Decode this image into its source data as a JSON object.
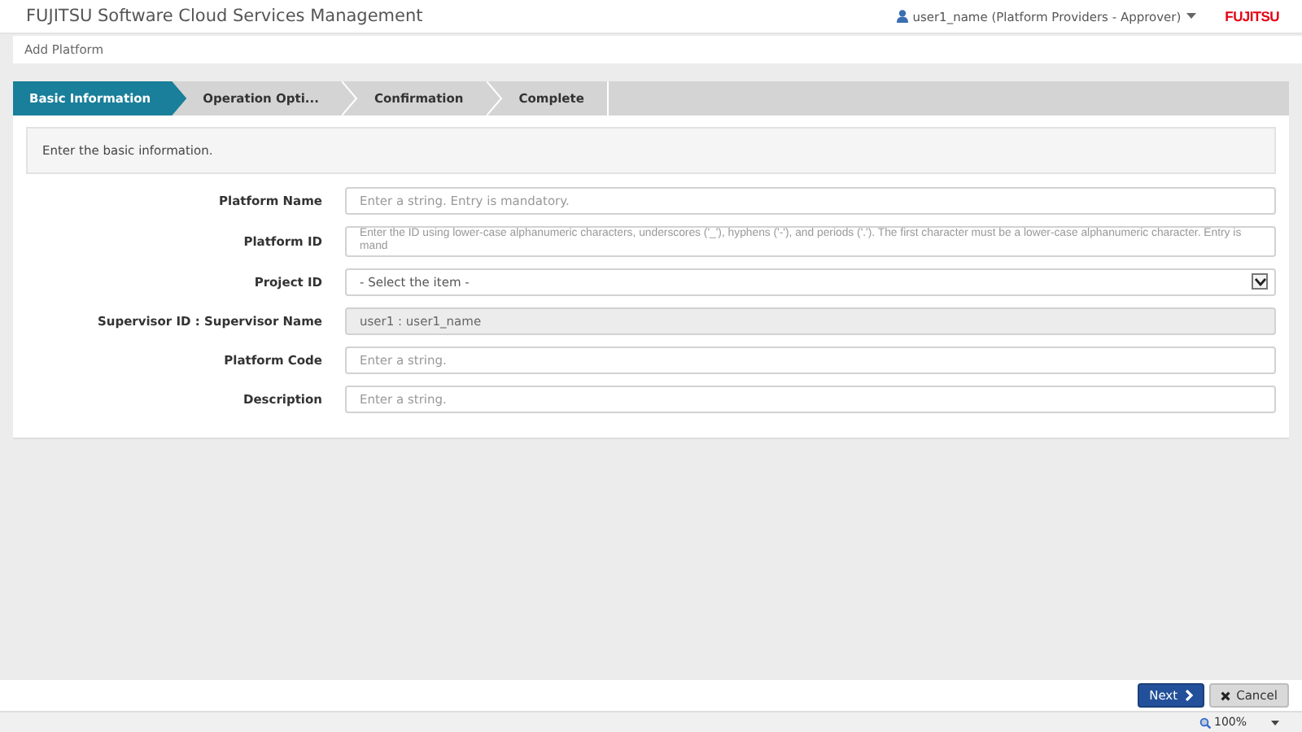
{
  "header": {
    "title": "FUJITSU Software Cloud Services Management",
    "user_menu": "user1_name (Platform Providers - Approver)",
    "logo": "FUJITSU"
  },
  "page_title": "Add Platform",
  "steps": [
    {
      "label": "Basic Information",
      "selected": true
    },
    {
      "label": "Operation Opti...",
      "selected": false
    },
    {
      "label": "Confirmation",
      "selected": false
    },
    {
      "label": "Complete",
      "selected": false
    }
  ],
  "instruction": "Enter the basic information.",
  "fields": [
    {
      "label": "Platform Name",
      "kind": "text",
      "placeholder": "Enter a string. Entry is mandatory."
    },
    {
      "label": "Platform ID",
      "kind": "text",
      "placeholder": "Enter the ID using lower-case alphanumeric characters, underscores ('_'), hyphens ('-'), and periods ('.'). The first character must be a lower-case alphanumeric character. Entry is mand"
    },
    {
      "label": "Project ID",
      "kind": "select",
      "value": "- Select the item -"
    },
    {
      "label": "Supervisor ID : Supervisor Name",
      "kind": "readonly",
      "value": "user1 : user1_name"
    },
    {
      "label": "Platform Code",
      "kind": "text",
      "placeholder": "Enter a string."
    },
    {
      "label": "Description",
      "kind": "text",
      "placeholder": "Enter a string."
    }
  ],
  "buttons": [
    {
      "label": "Next",
      "kind": "primary"
    },
    {
      "label": "Cancel",
      "kind": "secondary"
    }
  ],
  "status_bar": {
    "zoom": "100%"
  }
}
